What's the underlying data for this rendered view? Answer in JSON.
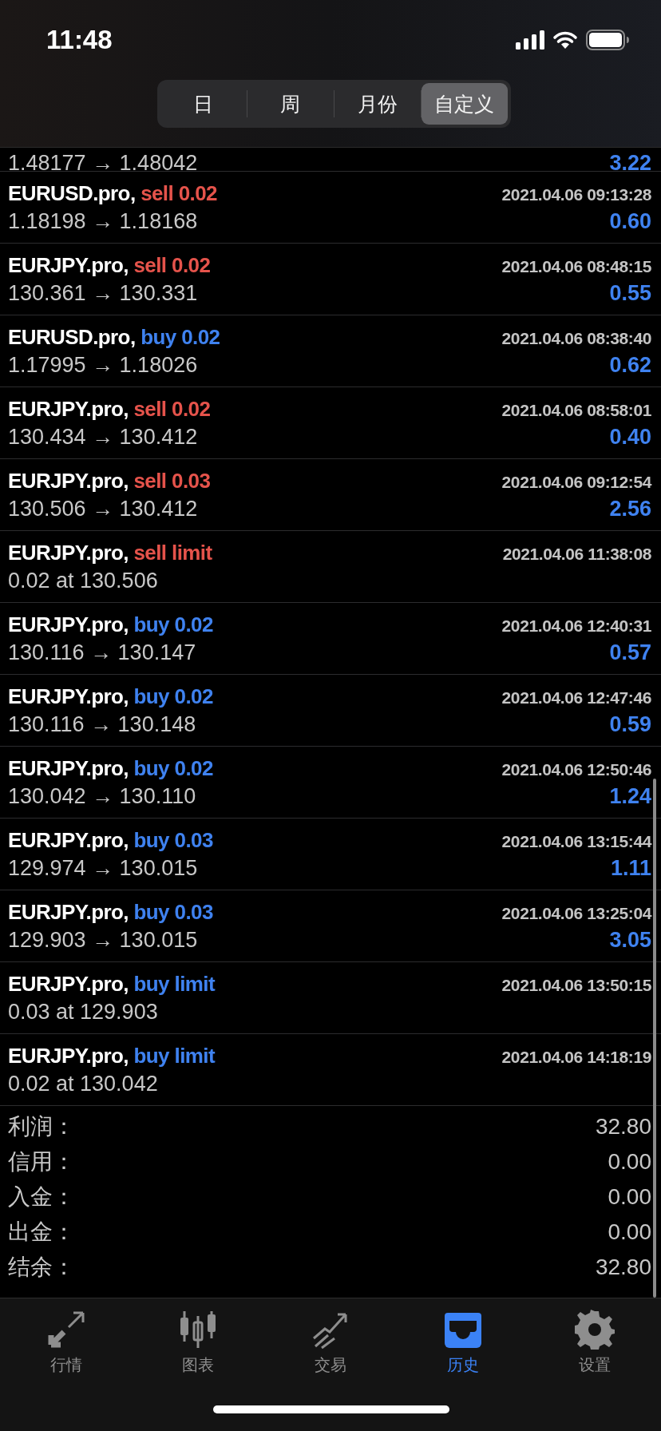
{
  "status_bar": {
    "time": "11:48"
  },
  "period_tabs": [
    {
      "label": "日",
      "selected": false
    },
    {
      "label": "周",
      "selected": false
    },
    {
      "label": "月份",
      "selected": false
    },
    {
      "label": "自定义",
      "selected": true
    }
  ],
  "partial_row": {
    "prices": "1.48177 → 1.48042",
    "profit": "3.22"
  },
  "deals": [
    {
      "symbol": "EURUSD.pro,",
      "kind": "sell",
      "order": "sell 0.02",
      "time": "2021.04.06 09:13:28",
      "prices": "1.18198 → 1.18168",
      "profit": "0.60"
    },
    {
      "symbol": "EURJPY.pro,",
      "kind": "sell",
      "order": "sell 0.02",
      "time": "2021.04.06 08:48:15",
      "prices": "130.361 → 130.331",
      "profit": "0.55"
    },
    {
      "symbol": "EURUSD.pro,",
      "kind": "buy",
      "order": "buy 0.02",
      "time": "2021.04.06 08:38:40",
      "prices": "1.17995 → 1.18026",
      "profit": "0.62"
    },
    {
      "symbol": "EURJPY.pro,",
      "kind": "sell",
      "order": "sell 0.02",
      "time": "2021.04.06 08:58:01",
      "prices": "130.434 → 130.412",
      "profit": "0.40"
    },
    {
      "symbol": "EURJPY.pro,",
      "kind": "sell",
      "order": "sell 0.03",
      "time": "2021.04.06 09:12:54",
      "prices": "130.506 → 130.412",
      "profit": "2.56"
    },
    {
      "symbol": "EURJPY.pro,",
      "kind": "sell",
      "order": "sell limit",
      "time": "2021.04.06 11:38:08",
      "prices": "0.02 at 130.506"
    },
    {
      "symbol": "EURJPY.pro,",
      "kind": "buy",
      "order": "buy 0.02",
      "time": "2021.04.06 12:40:31",
      "prices": "130.116 → 130.147",
      "profit": "0.57"
    },
    {
      "symbol": "EURJPY.pro,",
      "kind": "buy",
      "order": "buy 0.02",
      "time": "2021.04.06 12:47:46",
      "prices": "130.116 → 130.148",
      "profit": "0.59"
    },
    {
      "symbol": "EURJPY.pro,",
      "kind": "buy",
      "order": "buy 0.02",
      "time": "2021.04.06 12:50:46",
      "prices": "130.042 → 130.110",
      "profit": "1.24"
    },
    {
      "symbol": "EURJPY.pro,",
      "kind": "buy",
      "order": "buy 0.03",
      "time": "2021.04.06 13:15:44",
      "prices": "129.974 → 130.015",
      "profit": "1.11"
    },
    {
      "symbol": "EURJPY.pro,",
      "kind": "buy",
      "order": "buy 0.03",
      "time": "2021.04.06 13:25:04",
      "prices": "129.903 → 130.015",
      "profit": "3.05"
    },
    {
      "symbol": "EURJPY.pro,",
      "kind": "buy",
      "order": "buy limit",
      "time": "2021.04.06 13:50:15",
      "prices": "0.03 at 129.903"
    },
    {
      "symbol": "EURJPY.pro,",
      "kind": "buy",
      "order": "buy limit",
      "time": "2021.04.06 14:18:19",
      "prices": "0.02 at 130.042"
    }
  ],
  "summary": [
    {
      "label": "利润：",
      "value": "32.80"
    },
    {
      "label": "信用：",
      "value": "0.00"
    },
    {
      "label": "入金：",
      "value": "0.00"
    },
    {
      "label": "出金：",
      "value": "0.00"
    },
    {
      "label": "结余：",
      "value": "32.80"
    }
  ],
  "tab_bar": [
    {
      "label": "行情",
      "selected": false
    },
    {
      "label": "图表",
      "selected": false
    },
    {
      "label": "交易",
      "selected": false
    },
    {
      "label": "历史",
      "selected": true
    },
    {
      "label": "设置",
      "selected": false
    }
  ]
}
